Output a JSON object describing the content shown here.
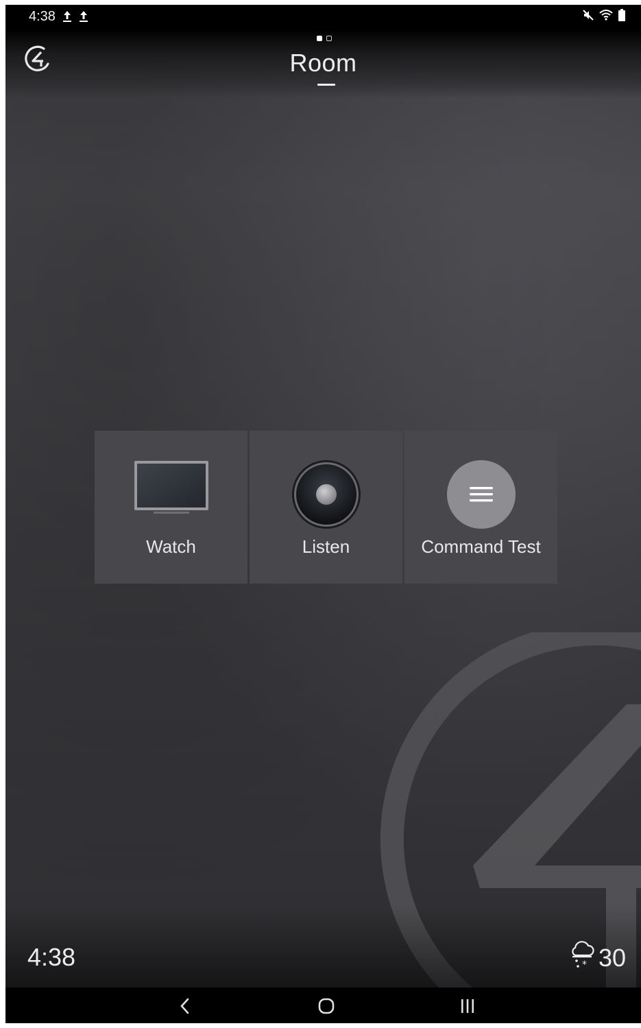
{
  "status_bar": {
    "time": "4:38",
    "icons": [
      "upload-icon",
      "upload-icon",
      "mute-icon",
      "wifi-icon",
      "battery-icon"
    ]
  },
  "header": {
    "logo_icon": "control4-logo-icon",
    "title": "Room",
    "page_indicator": {
      "total": 2,
      "active": 1
    }
  },
  "tiles": [
    {
      "label": "Watch",
      "icon": "tv-icon"
    },
    {
      "label": "Listen",
      "icon": "speaker-icon"
    },
    {
      "label": "Command Test",
      "icon": "menu-icon"
    }
  ],
  "footer": {
    "clock": "4:38",
    "weather_icon": "snow-cloud-icon",
    "temperature": "30"
  },
  "nav_bar": {
    "icons": [
      "back-icon",
      "home-icon",
      "recents-icon"
    ]
  },
  "colors": {
    "background": "#3a3a3e",
    "tile": "#48484c",
    "text": "#ededed"
  }
}
